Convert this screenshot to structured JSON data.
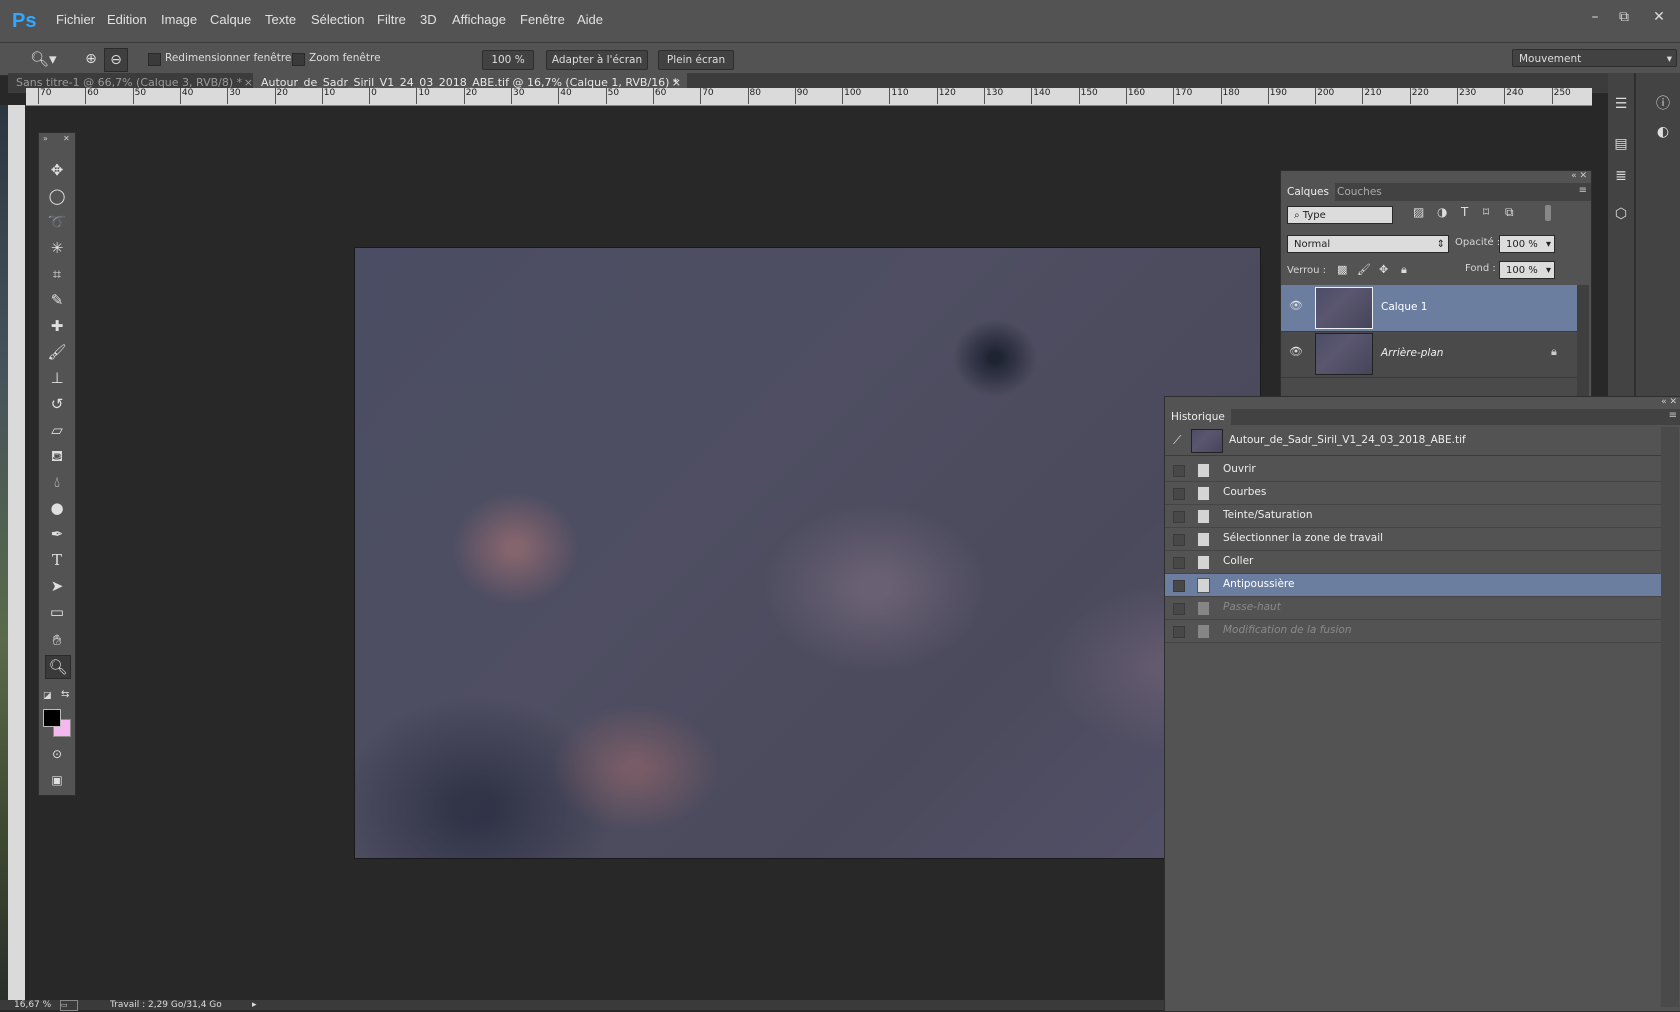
{
  "app": {
    "logo": "Ps"
  },
  "menu": [
    "Fichier",
    "Edition",
    "Image",
    "Calque",
    "Texte",
    "Sélection",
    "Filtre",
    "3D",
    "Affichage",
    "Fenêtre",
    "Aide"
  ],
  "window_controls": {
    "minimize": "–",
    "restore": "⧉",
    "close": "✕"
  },
  "options": {
    "resize_windows": "Redimensionner fenêtres",
    "zoom_window": "Zoom fenêtre",
    "zoom_100": "100 %",
    "fit_screen": "Adapter à l'écran",
    "full_screen": "Plein écran",
    "workspace": "Mouvement"
  },
  "tabs": [
    {
      "label": "Sans titre-1 @ 66,7% (Calque 3, RVB/8) *",
      "active": false
    },
    {
      "label": "Autour_de_Sadr_Siril_V1_24_03_2018_ABE.tif @ 16,7% (Calque 1, RVB/16) *",
      "active": true
    }
  ],
  "tab_close": "×",
  "ruler_h": [
    "70",
    "60",
    "50",
    "40",
    "30",
    "20",
    "10",
    "0",
    "10",
    "20",
    "30",
    "40",
    "50",
    "60",
    "70",
    "80",
    "90",
    "100",
    "110",
    "120",
    "130",
    "140",
    "150",
    "160",
    "170",
    "180",
    "190",
    "200",
    "210",
    "220",
    "230",
    "240",
    "250",
    "2"
  ],
  "layers_panel": {
    "tabs": [
      "Calques",
      "Couches"
    ],
    "filter_type": "Type",
    "blend_mode": "Normal",
    "opacity_label": "Opacité :",
    "opacity_value": "100 %",
    "lock_label": "Verrou :",
    "fill_label": "Fond :",
    "fill_value": "100 %",
    "layers": [
      {
        "name": "Calque 1",
        "selected": true,
        "italic": false
      },
      {
        "name": "Arrière-plan",
        "selected": false,
        "italic": true
      }
    ]
  },
  "history_panel": {
    "title": "Historique",
    "snapshot": "Autour_de_Sadr_Siril_V1_24_03_2018_ABE.tif",
    "steps": [
      {
        "label": "Ouvrir",
        "state": "normal"
      },
      {
        "label": "Courbes",
        "state": "normal"
      },
      {
        "label": "Teinte/Saturation",
        "state": "normal"
      },
      {
        "label": "Sélectionner la zone de travail",
        "state": "normal"
      },
      {
        "label": "Coller",
        "state": "normal"
      },
      {
        "label": "Antipoussière",
        "state": "selected"
      },
      {
        "label": "Passe-haut",
        "state": "dimmed"
      },
      {
        "label": "Modification de la fusion",
        "state": "dimmed"
      }
    ]
  },
  "status": {
    "zoom": "16,67 %",
    "info": "Travail : 2,29 Go/31,4 Go"
  },
  "colors": {
    "foreground": "#000000",
    "background": "#f4b8ee",
    "selection": "#6b7ea0"
  }
}
